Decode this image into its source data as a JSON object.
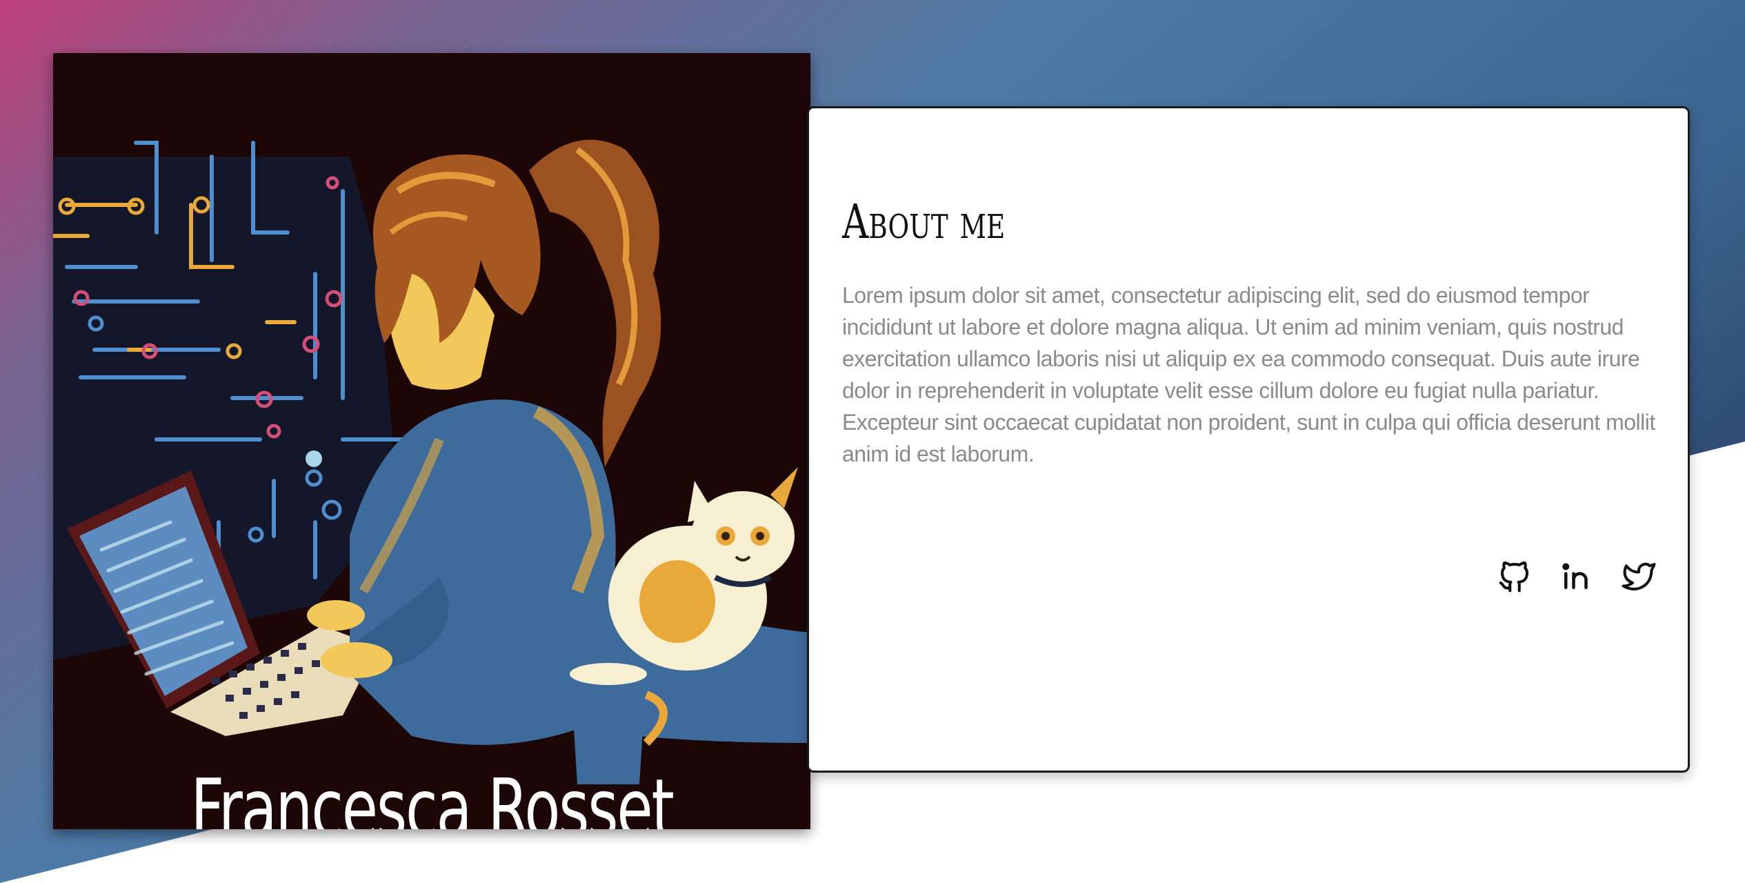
{
  "profile": {
    "name": "Francesca Rosset"
  },
  "about": {
    "title": "About me",
    "text": "Lorem ipsum dolor sit amet, consectetur adipiscing elit, sed do eiusmod tempor incididunt ut labore et dolore magna aliqua. Ut enim ad minim veniam, quis nostrud exercitation ullamco laboris nisi ut aliquip ex ea commodo consequat. Duis aute irure dolor in reprehenderit in voluptate velit esse cillum dolore eu fugiat nulla pariatur. Excepteur sint occaecat cupidatat non proident, sunt in culpa qui officia deserunt mollit anim id est laborum."
  },
  "socials": [
    {
      "icon": "github-icon"
    },
    {
      "icon": "linkedin-icon"
    },
    {
      "icon": "twitter-icon"
    }
  ],
  "colors": {
    "gradient_pink": "#b8407a",
    "gradient_blue": "#4a7aa8",
    "gradient_navy": "#2f4f78",
    "portrait_bg": "#1c0606",
    "card_border": "#1a1a1a",
    "text_gray": "#8a8a8a"
  }
}
